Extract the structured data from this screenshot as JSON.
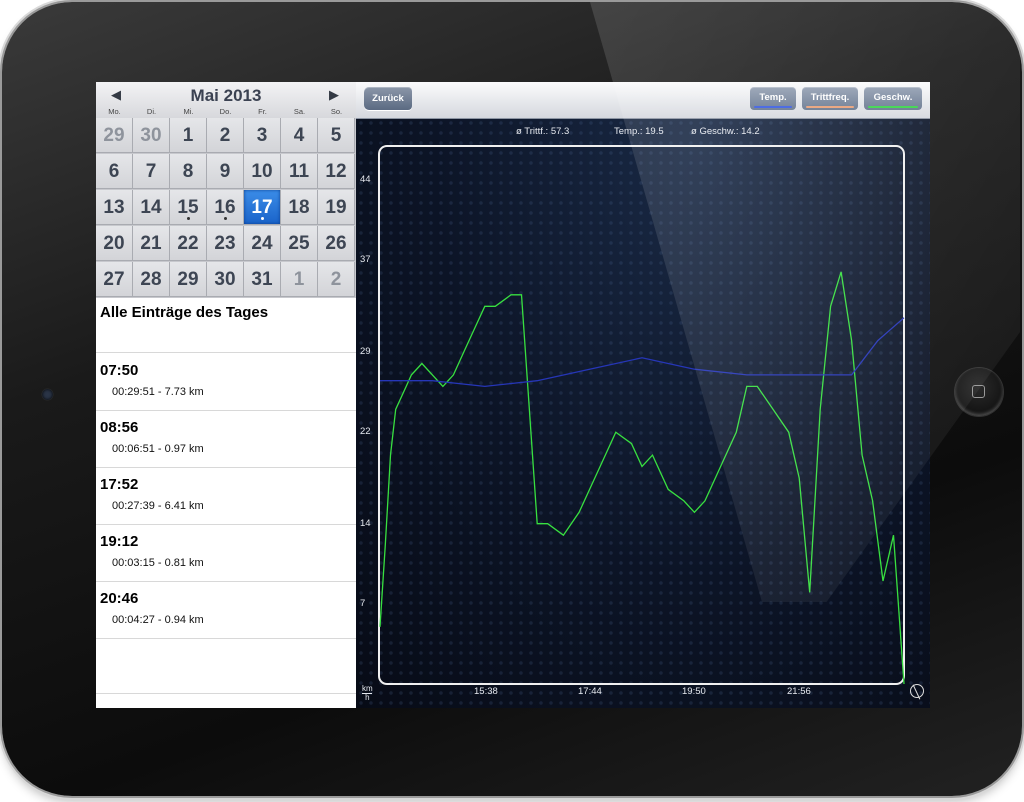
{
  "calendar": {
    "title": "Mai 2013",
    "prev_icon": "triangle-left-icon",
    "next_icon": "triangle-right-icon",
    "weekdays": [
      "Mo.",
      "Di.",
      "Mi.",
      "Do.",
      "Fr.",
      "Sa.",
      "So."
    ],
    "weeks": [
      [
        {
          "d": "29",
          "out": true
        },
        {
          "d": "30",
          "out": true
        },
        {
          "d": "1"
        },
        {
          "d": "2"
        },
        {
          "d": "3"
        },
        {
          "d": "4"
        },
        {
          "d": "5"
        }
      ],
      [
        {
          "d": "6"
        },
        {
          "d": "7"
        },
        {
          "d": "8"
        },
        {
          "d": "9"
        },
        {
          "d": "10"
        },
        {
          "d": "11"
        },
        {
          "d": "12"
        }
      ],
      [
        {
          "d": "13"
        },
        {
          "d": "14"
        },
        {
          "d": "15",
          "dot": true
        },
        {
          "d": "16",
          "dot": true
        },
        {
          "d": "17",
          "dot": true,
          "selected": true
        },
        {
          "d": "18"
        },
        {
          "d": "19"
        }
      ],
      [
        {
          "d": "20"
        },
        {
          "d": "21"
        },
        {
          "d": "22"
        },
        {
          "d": "23"
        },
        {
          "d": "24"
        },
        {
          "d": "25"
        },
        {
          "d": "26"
        }
      ],
      [
        {
          "d": "27"
        },
        {
          "d": "28"
        },
        {
          "d": "29"
        },
        {
          "d": "30"
        },
        {
          "d": "31"
        },
        {
          "d": "1",
          "out": true
        },
        {
          "d": "2",
          "out": true
        }
      ]
    ],
    "selected_color": "#1f6fd6"
  },
  "entries": {
    "header": "Alle Einträge des Tages",
    "items": [
      {
        "time": "07:50",
        "detail": "00:29:51 - 7.73 km"
      },
      {
        "time": "08:56",
        "detail": "00:06:51 - 0.97 km"
      },
      {
        "time": "17:52",
        "detail": "00:27:39 - 6.41 km"
      },
      {
        "time": "19:12",
        "detail": "00:03:15 - 0.81 km"
      },
      {
        "time": "20:46",
        "detail": "00:04:27 - 0.94 km"
      }
    ]
  },
  "toolbar": {
    "back_label": "Zurück",
    "buttons": [
      {
        "label": "Temp.",
        "color": "#3a5de0"
      },
      {
        "label": "Trittfreq.",
        "color": "#e8a078"
      },
      {
        "label": "Geschw.",
        "color": "#3ad44a"
      }
    ]
  },
  "stats": {
    "cadence": "ø Trittf.: 57.3",
    "temp": "Temp.: 19.5",
    "speed": "ø Geschw.: 14.2"
  },
  "units": {
    "top": "km",
    "bottom": "h"
  },
  "chart_data": {
    "type": "line",
    "y_ticks": [
      "44",
      "37",
      "29",
      "22",
      "14",
      "7"
    ],
    "x_ticks": [
      "15:38",
      "17:44",
      "19:50",
      "21:56"
    ],
    "ylim": [
      0,
      47
    ],
    "grid": false,
    "series": [
      {
        "color": "#38e040",
        "x": [
          0,
          1,
          2,
          3,
          5,
          6,
          8,
          10,
          12,
          14,
          16,
          18,
          20,
          22,
          25,
          27,
          30,
          32,
          35,
          38,
          40,
          42,
          45,
          48,
          50,
          52,
          55,
          58,
          60,
          62,
          65,
          68,
          70,
          72,
          75,
          78,
          80,
          82,
          84,
          86,
          88,
          90,
          92,
          94,
          96,
          98,
          100
        ],
        "values": [
          5,
          12,
          20,
          24,
          26,
          27,
          28,
          27,
          26,
          27,
          29,
          31,
          33,
          33,
          34,
          34,
          14,
          14,
          13,
          15,
          17,
          19,
          22,
          21,
          19,
          20,
          17,
          16,
          15,
          16,
          19,
          22,
          26,
          26,
          24,
          22,
          18,
          8,
          24,
          33,
          36,
          30,
          20,
          16,
          9,
          13,
          0
        ]
      },
      {
        "color": "#2636b8",
        "x": [
          0,
          10,
          20,
          30,
          40,
          50,
          60,
          70,
          80,
          90,
          95,
          100
        ],
        "values": [
          26.5,
          26.5,
          26,
          26.5,
          27.5,
          28.5,
          27.5,
          27,
          27,
          27,
          30,
          32
        ]
      }
    ]
  }
}
